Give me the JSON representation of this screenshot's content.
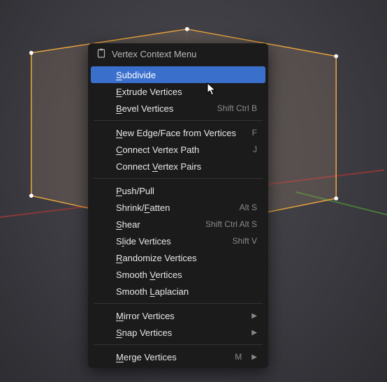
{
  "menu": {
    "title": "Vertex Context Menu",
    "groups": [
      [
        {
          "id": "subdivide",
          "label": "Subdivide",
          "ul": 0,
          "highlight": true
        },
        {
          "id": "extrude-vertices",
          "label": "Extrude Vertices",
          "ul": 0
        },
        {
          "id": "bevel-vertices",
          "label": "Bevel Vertices",
          "ul": 0,
          "shortcut": "Shift Ctrl B"
        }
      ],
      [
        {
          "id": "new-edge-face",
          "label": "New Edge/Face from Vertices",
          "ul": 0,
          "shortcut": "F"
        },
        {
          "id": "connect-vertex-path",
          "label": "Connect Vertex Path",
          "ul": 0,
          "shortcut": "J"
        },
        {
          "id": "connect-vertex-pairs",
          "label": "Connect Vertex Pairs",
          "ul": 8
        }
      ],
      [
        {
          "id": "push-pull",
          "label": "Push/Pull",
          "ul": 0
        },
        {
          "id": "shrink-fatten",
          "label": "Shrink/Fatten",
          "ul": 7,
          "shortcut": "Alt S"
        },
        {
          "id": "shear",
          "label": "Shear",
          "ul": 0,
          "shortcut": "Shift Ctrl Alt S"
        },
        {
          "id": "slide-vertices",
          "label": "Slide Vertices",
          "ul": 1,
          "shortcut": "Shift V"
        },
        {
          "id": "randomize-vertices",
          "label": "Randomize Vertices",
          "ul": 0
        },
        {
          "id": "smooth-vertices",
          "label": "Smooth Vertices",
          "ul": 7
        },
        {
          "id": "smooth-laplacian",
          "label": "Smooth Laplacian",
          "ul": 7
        }
      ],
      [
        {
          "id": "mirror-vertices",
          "label": "Mirror Vertices",
          "ul": 0,
          "submenu": true
        },
        {
          "id": "snap-vertices",
          "label": "Snap Vertices",
          "ul": 0,
          "submenu": true
        }
      ],
      [
        {
          "id": "merge-vertices",
          "label": "Merge Vertices",
          "ul": 0,
          "shortcut": "M",
          "submenu": true
        }
      ]
    ]
  },
  "colors": {
    "wireframe_select": "#e8a33c",
    "vertex": "#d9d9d9",
    "vertex_sel": "#ffffff"
  }
}
